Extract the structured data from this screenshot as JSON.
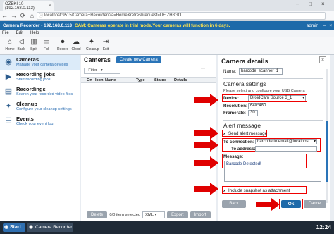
{
  "browser": {
    "tab_title": "OZEKI 10 (192.168.0.113)",
    "url": "localhost:9515/Camera+Recorder/?a=Home&refreshrequest=UFIZH8GO",
    "nav": {
      "back": "←",
      "forward": "→",
      "reload": "⟳",
      "home": "⌂"
    }
  },
  "app": {
    "title": "Camera Recorder - 192.168.0.113",
    "notice": "CAM: Cameras operate in trial mode.Your cameras will function in 6 days.",
    "user": "admin",
    "menu": [
      "File",
      "Edit",
      "Help"
    ],
    "toolbar": [
      "Home",
      "Back",
      "Split",
      "Full",
      "Record",
      "Cloud",
      "Cleanup",
      "Exit"
    ]
  },
  "sidebar": {
    "items": [
      {
        "title": "Cameras",
        "desc": "Manage your camera devices",
        "icon": "camera-icon",
        "active": true
      },
      {
        "title": "Recording jobs",
        "desc": "Start recording jobs",
        "icon": "recording-icon",
        "active": false
      },
      {
        "title": "Recordings",
        "desc": "Search your recorded video files",
        "icon": "film-icon",
        "active": false
      },
      {
        "title": "Cleanup",
        "desc": "Configure your cleanup settings",
        "icon": "cleanup-icon",
        "active": false
      },
      {
        "title": "Events",
        "desc": "Check your event log",
        "icon": "events-icon",
        "active": false
      }
    ]
  },
  "cameras_panel": {
    "title": "Cameras",
    "create_button": "Create new Camera",
    "filter": "- Filter -",
    "columns": [
      "On",
      "Icon",
      "Name",
      "Type",
      "Status",
      "Details"
    ],
    "delete_button": "Delete",
    "selection": "0/0 item selected",
    "format": "XML",
    "export_button": "Export",
    "import_button": "Import"
  },
  "details": {
    "title": "Camera details",
    "name_label": "Name:",
    "name_value": "barcode_scanner_1",
    "camera_settings_heading": "Camera settings",
    "camera_hint": "Please select and configure your USB Camera",
    "device_label": "Device:",
    "device_value": "DroidCam Source 3_1",
    "resolution_label": "Resolution:",
    "resolution_value": "640*480",
    "framerate_label": "Framerate:",
    "framerate_value": "30",
    "alert_heading": "Alert message",
    "send_alert_label": "Send alert message",
    "to_connection_label": "To connection:",
    "to_connection_value": "barcode to email@localhost",
    "to_address_label": "To address:",
    "to_address_value": "",
    "message_label": "Message:",
    "message_value": "Barcode Detected!",
    "snapshot_label": "Include snapshot as attachment",
    "back_button": "Back",
    "ok_button": "Ok",
    "cancel_button": "Cancel"
  },
  "taskbar": {
    "start": "Start",
    "item": "Camera Recorder",
    "clock": "12:24"
  },
  "colors": {
    "accent": "#1e6aa9",
    "annotation": "#e00000",
    "notice": "#ffe34d"
  }
}
